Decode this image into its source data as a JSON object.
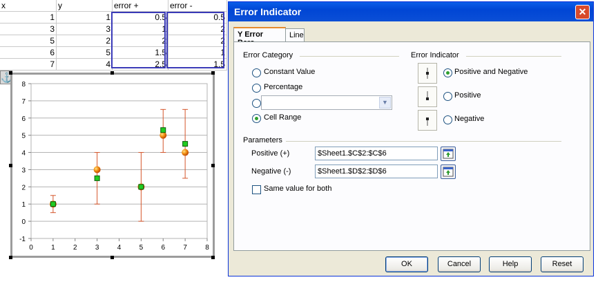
{
  "spreadsheet": {
    "headers": [
      "x",
      "y",
      "error +",
      "error -"
    ],
    "rows": [
      [
        "1",
        "1",
        "0.5",
        "0.5"
      ],
      [
        "3",
        "3",
        "1",
        "2"
      ],
      [
        "5",
        "2",
        "2",
        "2"
      ],
      [
        "6",
        "5",
        "1.5",
        "1"
      ],
      [
        "7",
        "4",
        "2.5",
        "1.5"
      ]
    ]
  },
  "chart_data": {
    "type": "scatter",
    "xlim": [
      0,
      8
    ],
    "ylim": [
      -1,
      8
    ],
    "xticks": [
      "0",
      "1",
      "2",
      "3",
      "4",
      "5",
      "6",
      "7",
      "8"
    ],
    "yticks": [
      "-1",
      "0",
      "1",
      "2",
      "3",
      "4",
      "5",
      "6",
      "7",
      "8"
    ],
    "grid": true,
    "series": [
      {
        "marker": "orange-sphere",
        "color": "#e8720c",
        "x": [
          1,
          3,
          5,
          6,
          7
        ],
        "y": [
          1,
          3,
          2,
          5,
          4
        ],
        "error_plus": [
          0.5,
          1,
          2,
          1.5,
          2.5
        ],
        "error_minus": [
          0.5,
          2,
          2,
          1,
          1.5
        ]
      },
      {
        "marker": "green-square",
        "color": "#22cc22",
        "x": [
          1,
          3,
          5,
          6,
          7
        ],
        "y": [
          1,
          2.5,
          2,
          5.3,
          4.5
        ]
      }
    ],
    "error_bar_color": "#d4552a"
  },
  "dialog": {
    "title": "Error Indicator",
    "tabs": [
      "Y Error Bars",
      "Line"
    ],
    "active_tab": "Y Error Bars",
    "error_category": {
      "label": "Error Category",
      "options": [
        "Constant Value",
        "Percentage",
        "",
        "Cell Range"
      ],
      "selected": "Cell Range",
      "combo_value": ""
    },
    "error_indicator": {
      "label": "Error Indicator",
      "options": [
        "Positive and Negative",
        "Positive",
        "Negative"
      ],
      "selected": "Positive and Negative"
    },
    "parameters": {
      "label": "Parameters",
      "positive_label": "Positive (+)",
      "positive_value": "$Sheet1.$C$2:$C$6",
      "negative_label": "Negative (-)",
      "negative_value": "$Sheet1.$D$2:$D$6",
      "same_value_label": "Same value for both",
      "same_value_checked": false
    },
    "buttons": {
      "ok": "OK",
      "cancel": "Cancel",
      "help": "Help",
      "reset": "Reset"
    }
  },
  "colors": {
    "title_bar": "#0054e3",
    "dialog_bg": "#ece9d8",
    "selection_border": "#3a3ab8",
    "radio_dot": "#2fa02f"
  }
}
